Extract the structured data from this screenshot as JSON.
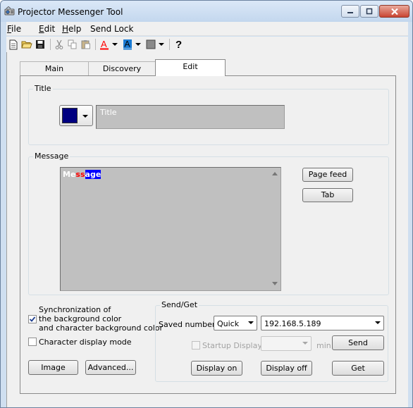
{
  "window": {
    "title": "Projector Messenger Tool"
  },
  "menu": [
    {
      "label": "File",
      "u": "F",
      "rest": "ile"
    },
    {
      "label": "Edit",
      "u": "E",
      "rest": "dit"
    },
    {
      "label": "Help",
      "u": "H",
      "rest": "elp"
    },
    {
      "label": "Send Lock",
      "u": "",
      "rest": "Send Lock"
    }
  ],
  "tabs": [
    {
      "label": "Main"
    },
    {
      "label": "Discovery"
    },
    {
      "label": "Edit"
    }
  ],
  "title_group": {
    "label": "Title",
    "text_placeholder": "Title",
    "color": "#000080"
  },
  "message_group": {
    "label": "Message",
    "text_parts": [
      "Me",
      "ss",
      "a",
      "ge"
    ],
    "page_feed_label": "Page feed",
    "tab_label": "Tab"
  },
  "sync_checkbox": {
    "checked": true,
    "line1": "Synchronization of",
    "line2": "the background color",
    "line3": "and character background color"
  },
  "char_display_checkbox": {
    "checked": false,
    "label": "Character display mode"
  },
  "buttons": {
    "image": "Image",
    "advanced": "Advanced...",
    "send": "Send",
    "display_on": "Display on",
    "display_off": "Display off",
    "get": "Get"
  },
  "send_get": {
    "label": "Send/Get",
    "saved_number_label": "Saved number",
    "mode_value": "Quick",
    "ip_value": "192.168.5.189",
    "startup_display_label": "Startup Display",
    "min_label": "min"
  },
  "colors": {
    "titlebar": "#c3d7ee",
    "panel_gray": "#c0c0c0",
    "navy": "#000080",
    "highlight_blue": "#0000ff",
    "message_red": "#ff0000"
  }
}
